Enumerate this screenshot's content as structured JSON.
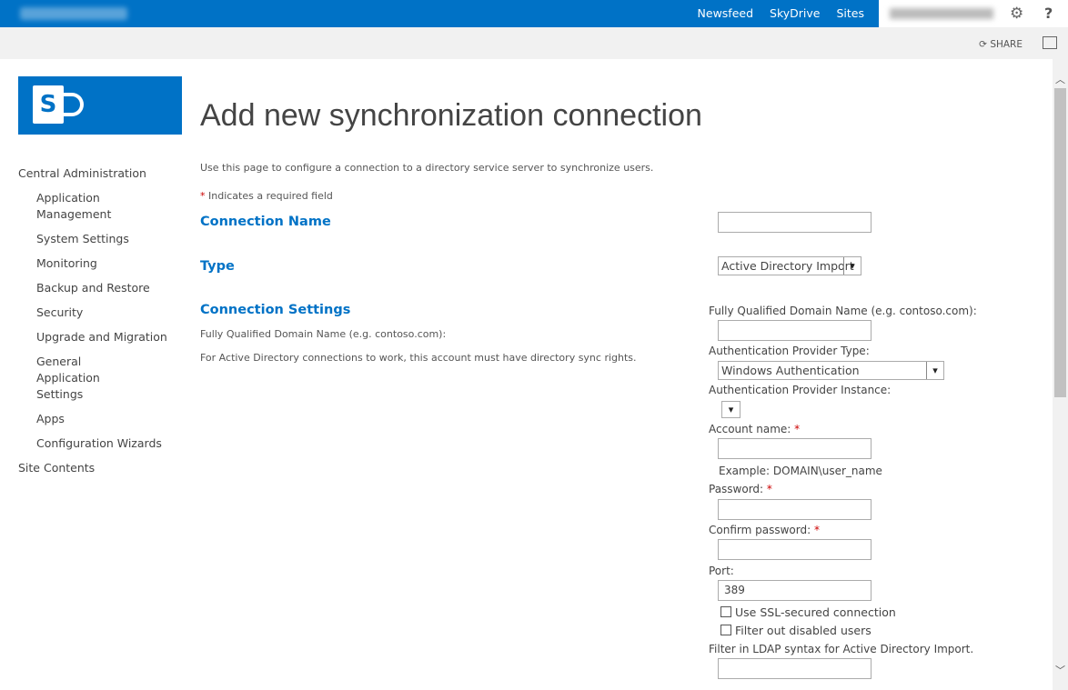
{
  "topbar": {
    "links": [
      "Newsfeed",
      "SkyDrive",
      "Sites"
    ]
  },
  "subbar": {
    "share": "SHARE"
  },
  "page": {
    "title": "Add new synchronization connection",
    "description": "Use this page to configure a connection to a directory service server to synchronize users.",
    "required_note": "Indicates a required field",
    "required_mark": "*"
  },
  "nav": {
    "items": [
      "Central Administration",
      "Application Management",
      "System Settings",
      "Monitoring",
      "Backup and Restore",
      "Security",
      "Upgrade and Migration",
      "General Application Settings",
      "Apps",
      "Configuration Wizards",
      "Site Contents"
    ]
  },
  "sections": {
    "connection_name": "Connection Name",
    "type": "Type",
    "connection_settings": "Connection Settings",
    "cs_desc1": "Fully Qualified Domain Name (e.g. contoso.com):",
    "cs_desc2": "For Active Directory connections to work, this account must have directory sync rights."
  },
  "form": {
    "type_value": "Active Directory Import",
    "fqdn_label": "Fully Qualified Domain Name (e.g. contoso.com):",
    "auth_type_label": "Authentication Provider Type:",
    "auth_type_value": "Windows Authentication",
    "auth_instance_label": "Authentication Provider Instance:",
    "account_label": "Account name:",
    "account_example": "Example: DOMAIN\\user_name",
    "password_label": "Password:",
    "confirm_label": "Confirm password:",
    "port_label": "Port:",
    "port_value": "389",
    "ssl_label": "Use SSL-secured connection",
    "filter_disabled_label": "Filter out disabled users",
    "ldap_label": "Filter in LDAP syntax for Active Directory Import."
  },
  "colors": {
    "brand": "#0072c6"
  }
}
